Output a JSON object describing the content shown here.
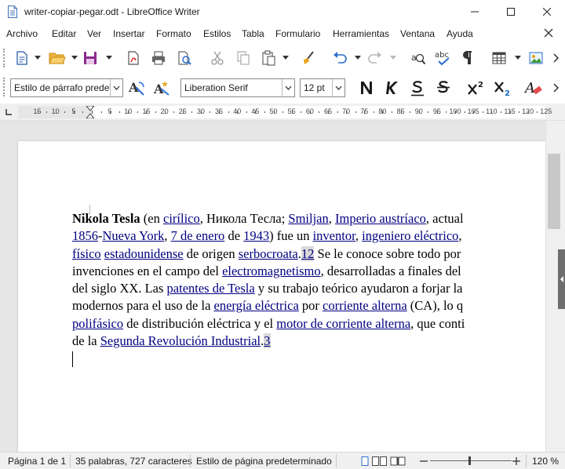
{
  "window": {
    "title": "writer-copiar-pegar.odt - LibreOffice Writer",
    "minimize_icon": "minimize-icon",
    "maximize_icon": "maximize-icon",
    "close_icon": "close-icon"
  },
  "menu": {
    "items": [
      "Archivo",
      "Editar",
      "Ver",
      "Insertar",
      "Formato",
      "Estilos",
      "Tabla",
      "Formulario",
      "Herramientas",
      "Ventana",
      "Ayuda"
    ]
  },
  "toolbar2": {
    "paragraph_style": "Estilo de párrafo predet",
    "font_name": "Liberation Serif",
    "font_size": "12 pt"
  },
  "ruler": {
    "labels": [
      "15",
      "10",
      "5",
      "5",
      "10",
      "15",
      "20",
      "25",
      "30",
      "35",
      "40",
      "45",
      "50",
      "55",
      "60",
      "65",
      "70",
      "75",
      "80",
      "85",
      "90",
      "95",
      "100",
      "105",
      "110",
      "115",
      "120",
      "125"
    ]
  },
  "document": {
    "paragraph": [
      [
        {
          "t": "Nikola Tesla",
          "s": "b"
        },
        {
          "t": " (en "
        },
        {
          "t": "cirílico",
          "s": "lk"
        },
        {
          "t": ", Никола Тесла; "
        },
        {
          "t": "Smiljan",
          "s": "lk"
        },
        {
          "t": ", "
        },
        {
          "t": "Imperio austríaco",
          "s": "lk"
        },
        {
          "t": ", actual"
        }
      ],
      [
        {
          "t": "1856",
          "s": "lk"
        },
        {
          "t": "-"
        },
        {
          "t": "Nueva York",
          "s": "lk"
        },
        {
          "t": ", "
        },
        {
          "t": "7 de enero",
          "s": "lk"
        },
        {
          "t": " de "
        },
        {
          "t": "1943",
          "s": "lk"
        },
        {
          "t": ") fue un "
        },
        {
          "t": "inventor",
          "s": "lk"
        },
        {
          "t": ", "
        },
        {
          "t": "ingeniero eléctrico",
          "s": "lk"
        },
        {
          "t": ", "
        }
      ],
      [
        {
          "t": "físico",
          "s": "lk"
        },
        {
          "t": " "
        },
        {
          "t": "estadounidense",
          "s": "lk"
        },
        {
          "t": " de origen "
        },
        {
          "t": "serbocroata",
          "s": "lk"
        },
        {
          "t": "."
        },
        {
          "t": "12",
          "s": "fn"
        },
        {
          "t": " Se le conoce sobre todo por"
        }
      ],
      [
        {
          "t": "invenciones en el campo del "
        },
        {
          "t": "electromagnetismo",
          "s": "lk"
        },
        {
          "t": ", desarrolladas a finales del"
        }
      ],
      [
        {
          "t": "del siglo XX. Las "
        },
        {
          "t": "patentes de Tesla",
          "s": "lk"
        },
        {
          "t": " y su trabajo teórico ayudaron a forjar la"
        }
      ],
      [
        {
          "t": "modernos para el uso de la "
        },
        {
          "t": "energía eléctrica",
          "s": "lk"
        },
        {
          "t": " por "
        },
        {
          "t": "corriente alterna",
          "s": "lk"
        },
        {
          "t": " (CA), lo q"
        }
      ],
      [
        {
          "t": "polifásico",
          "s": "lk"
        },
        {
          "t": " de distribución eléctrica y el "
        },
        {
          "t": "motor de corriente alterna",
          "s": "lk"
        },
        {
          "t": ", que conti"
        }
      ],
      [
        {
          "t": "de la "
        },
        {
          "t": "Segunda Revolución Industrial",
          "s": "lk"
        },
        {
          "t": "."
        },
        {
          "t": "3",
          "s": "fn"
        }
      ]
    ]
  },
  "status": {
    "page": "Página 1 de 1",
    "words": "35 palabras, 727 caracteres",
    "page_style": "Estilo de página predeterminado",
    "zoom": "120 %"
  },
  "colors": {
    "link": "#000080",
    "accent": "#1e6fc2",
    "toolbar_icon": "#2a2a2a"
  }
}
